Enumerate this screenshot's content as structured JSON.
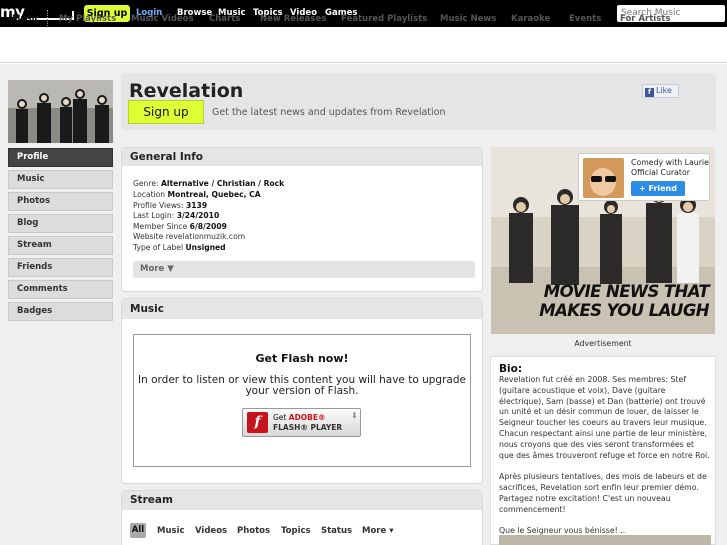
{
  "topbar": {
    "logo": "my",
    "signup": "Sign up",
    "login": "Login",
    "nav": [
      "Browse",
      "Music",
      "Topics",
      "Video",
      "Games"
    ],
    "search_placeholder": "Search Music"
  },
  "subnav": [
    "Music",
    "My Playlists",
    "Music Videos",
    "Charts",
    "New Releases",
    "Featured Playlists",
    "Music News",
    "Karaoke",
    "Events",
    "For Artists"
  ],
  "leftnav": [
    "Profile",
    "Music",
    "Photos",
    "Blog",
    "Stream",
    "Friends",
    "Comments",
    "Badges"
  ],
  "header": {
    "artist": "Revelation",
    "signup": "Sign up",
    "tagline": "Get the latest news and updates from Revelation",
    "fb_like": "Like"
  },
  "general_info": {
    "title": "General Info",
    "rows": [
      {
        "label": "Genre: ",
        "value": "Alternative / Christian / Rock"
      },
      {
        "label": "Location ",
        "value": "Montreal, Quebec, CA"
      },
      {
        "label": "Profile Views: ",
        "value": "3139"
      },
      {
        "label": "Last Login: ",
        "value": "3/24/2010"
      },
      {
        "label": "Member Since ",
        "value": "6/8/2009"
      },
      {
        "label": "Website ",
        "value": "revelationmuzik.com"
      },
      {
        "label": "Type of Label ",
        "value": "Unsigned"
      }
    ],
    "more": "More ▼"
  },
  "music": {
    "title": "Music",
    "flash_title": "Get Flash now!",
    "flash_text": "In order to listen or view this content you will have to upgrade your version of Flash.",
    "flash_get": "Get",
    "flash_adobe": "ADOBE®",
    "flash_player": "FLASH® PLAYER"
  },
  "stream": {
    "title": "Stream",
    "tabs": [
      "All",
      "Music",
      "Videos",
      "Photos",
      "Topics",
      "Status",
      "More ▾"
    ]
  },
  "ad": {
    "curator": "Comedy with Laurie",
    "curator_role": "Official Curator",
    "friend": "+ Friend",
    "headline1": "MOVIE NEWS THAT",
    "headline2": "MAKES YOU LAUGH",
    "label": "Advertisement"
  },
  "bio": {
    "title": "Bio:",
    "p1": "Revelation fut créé en 2008. Ses membres: Stef (guitare acoustique et voix), Dave (guitare électrique), Sam (basse) et Dan (batterie) ont trouvé un unité et un désir commun de louer, de laisser le Seigneur toucher les coeurs au travers leur musique. Chacun respectant ainsi une partie de leur ministère, nous croyons que des vies seront transformées et que des âmes trouveront refuge et force en notre Roi.",
    "p2": "Après plusieurs tentatives, des mois de labeurs et de sacrifices, Revelation sort enfin leur premier démo. Partagez notre excitation! C'est un nouveau commencement!",
    "p3": "Que le Seigneur vous bénisse! .."
  }
}
